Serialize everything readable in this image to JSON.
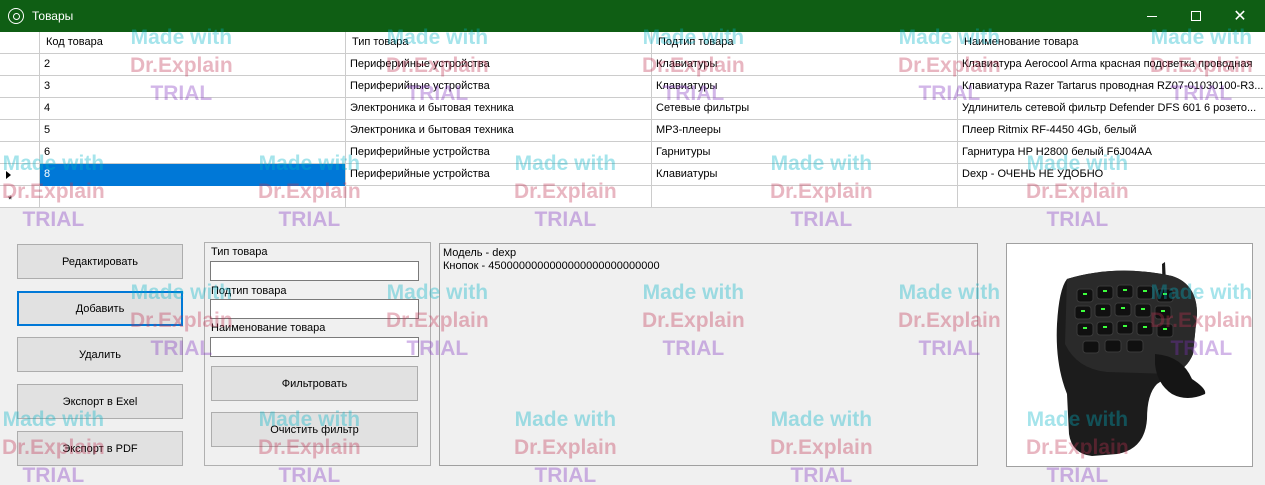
{
  "window": {
    "title": "Товары",
    "icon": "settings-gear-icon"
  },
  "grid": {
    "columns": [
      "Код товара",
      "Тип товара",
      "Подтип товара",
      "Наименование товара"
    ],
    "rows": [
      {
        "code": "2",
        "type": "Периферийные устройства",
        "subtype": "Клавиатуры",
        "name": "Клавиатура Aerocool Arma красная подсветка проводная"
      },
      {
        "code": "3",
        "type": "Периферийные устройства",
        "subtype": "Клавиатуры",
        "name": "Клавиатура Razer Tartarus проводная RZ07-01030100-R3..."
      },
      {
        "code": "4",
        "type": "Электроника и бытовая техника",
        "subtype": "Сетевые фильтры",
        "name": "Удлинитель сетевой фильтр Defender DFS 601 6 розето..."
      },
      {
        "code": "5",
        "type": "Электроника и бытовая техника",
        "subtype": "MP3-плееры",
        "name": "Плеер Ritmix RF-4450 4Gb, белый"
      },
      {
        "code": "6",
        "type": "Периферийные устройства",
        "subtype": "Гарнитуры",
        "name": "Гарнитура HP H2800 белый F6J04AA"
      },
      {
        "code": "8",
        "type": "Периферийные устройства",
        "subtype": "Клавиатуры",
        "name": "Dexp - ОЧЕНЬ НЕ УДОБНО"
      }
    ],
    "selected_row_index": 5,
    "new_row_marker": "*"
  },
  "buttons": {
    "edit": "Редактировать",
    "add": "Добавить",
    "delete": "Удалить",
    "export_excel": "Экспорт в Exel",
    "export_pdf": "Экспорт в PDF"
  },
  "filter": {
    "type_label": "Тип товара",
    "type_value": "",
    "subtype_label": "Подтип товара",
    "subtype_value": "",
    "name_label": "Наименование товара",
    "name_value": "",
    "apply_button": "Фильтровать",
    "clear_button": "Очистить фильтр"
  },
  "details": {
    "line1": "Модель - dexp",
    "line2": "Кнопок - 4500000000000000000000000000"
  },
  "watermark": {
    "line1": "Made with",
    "line2": "Dr.Explain",
    "line3": "TRIAL"
  },
  "colors": {
    "titlebar": "#0f5e14",
    "selection": "#0078d7"
  }
}
